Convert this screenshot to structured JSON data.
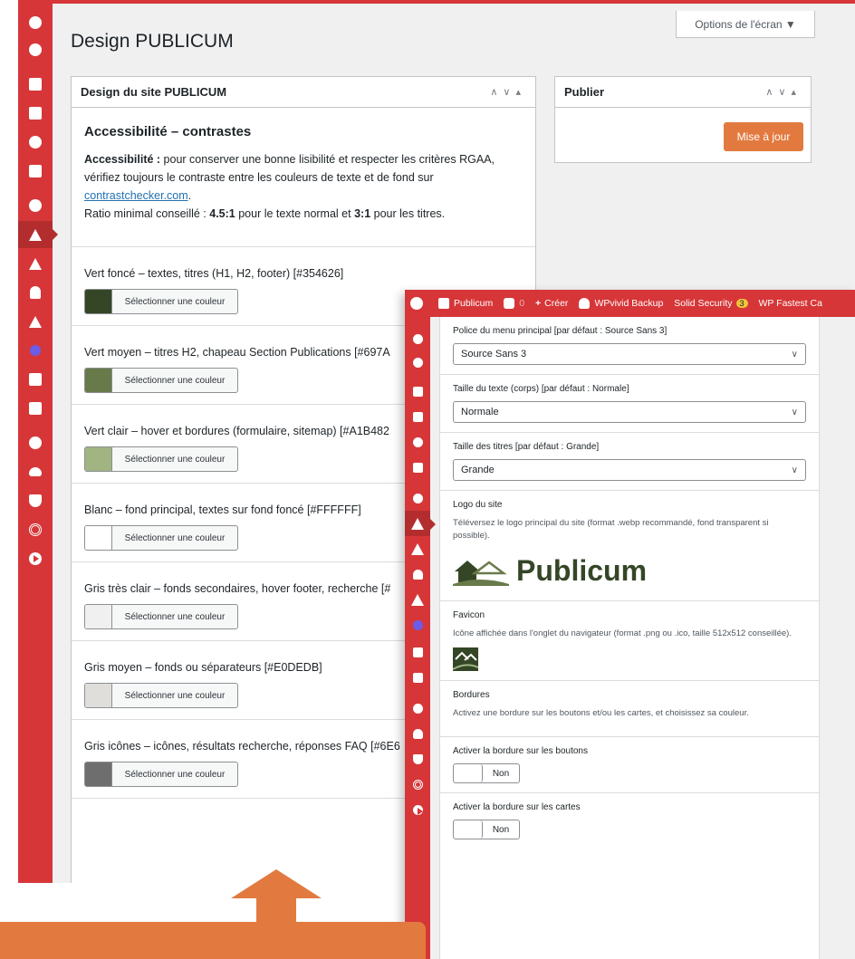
{
  "main": {
    "title": "Design PUBLICUM",
    "screen_options": "Options de l'écran ▼",
    "box_title": "Design du site PUBLICUM",
    "accessibility": {
      "heading": "Accessibilité – contrastes",
      "strong_label": "Accessibilité :",
      "text1": " pour conserver une bonne lisibilité et respecter les critères RGAA, vérifiez toujours le contraste entre les couleurs de texte et de fond sur ",
      "link": "contrastchecker.com",
      "text2": ".",
      "ratio_label": "Ratio minimal conseillé : ",
      "ratio_normal": "4.5:1",
      "ratio_mid": " pour le texte normal et ",
      "ratio_titles": "3:1",
      "ratio_end": " pour les titres."
    },
    "color_button_label": "Sélectionner une couleur",
    "colors": [
      {
        "label": "Vert foncé – textes, titres (H1, H2, footer) [#354626]",
        "hex": "#354626"
      },
      {
        "label": "Vert moyen – titres H2, chapeau Section Publications [#697A",
        "hex": "#697A4A"
      },
      {
        "label": "Vert clair – hover et bordures (formulaire, sitemap) [#A1B482",
        "hex": "#A1B482"
      },
      {
        "label": "Blanc – fond principal, textes sur fond foncé [#FFFFFF]",
        "hex": "#FFFFFF"
      },
      {
        "label": "Gris très clair – fonds secondaires, hover footer, recherche [#",
        "hex": "#F0F0F0"
      },
      {
        "label": "Gris moyen – fonds ou séparateurs [#E0DEDB]",
        "hex": "#E0DEDB"
      },
      {
        "label": "Gris icônes – icônes, résultats recherche, réponses FAQ [#6E6",
        "hex": "#6E6E6E"
      }
    ],
    "publish": {
      "title": "Publier",
      "update_button": "Mise à jour"
    }
  },
  "adminbar": {
    "site": "Publicum",
    "comments": "0",
    "create": "Créer",
    "backup": "WPvivid Backup",
    "security": "Solid Security",
    "security_count": "3",
    "cache": "WP Fastest Ca"
  },
  "settings": {
    "menu_font_label": "Police du menu principal [par défaut : Source Sans 3]",
    "menu_font_value": "Source Sans 3",
    "body_size_label": "Taille du texte (corps) [par défaut : Normale]",
    "body_size_value": "Normale",
    "title_size_label": "Taille des titres [par défaut : Grande]",
    "title_size_value": "Grande",
    "logo_label": "Logo du site",
    "logo_desc": "Téléversez le logo principal du site (format .webp recommandé, fond transparent si possible).",
    "logo_text": "Publicum",
    "favicon_label": "Favicon",
    "favicon_desc": "Icône affichée dans l'onglet du navigateur (format .png ou .ico, taille 512x512 conseillée).",
    "borders_label": "Bordures",
    "borders_desc": "Activez une bordure sur les boutons et/ou les cartes, et choisissez sa couleur.",
    "buttons_border_label": "Activer la bordure sur les boutons",
    "buttons_border_value": "Non",
    "cards_border_label": "Activer la bordure sur les cartes",
    "cards_border_value": "Non"
  },
  "colors": {
    "admin_red": "#d63638",
    "accent_orange": "#e27a3f",
    "brand_green": "#354626"
  }
}
